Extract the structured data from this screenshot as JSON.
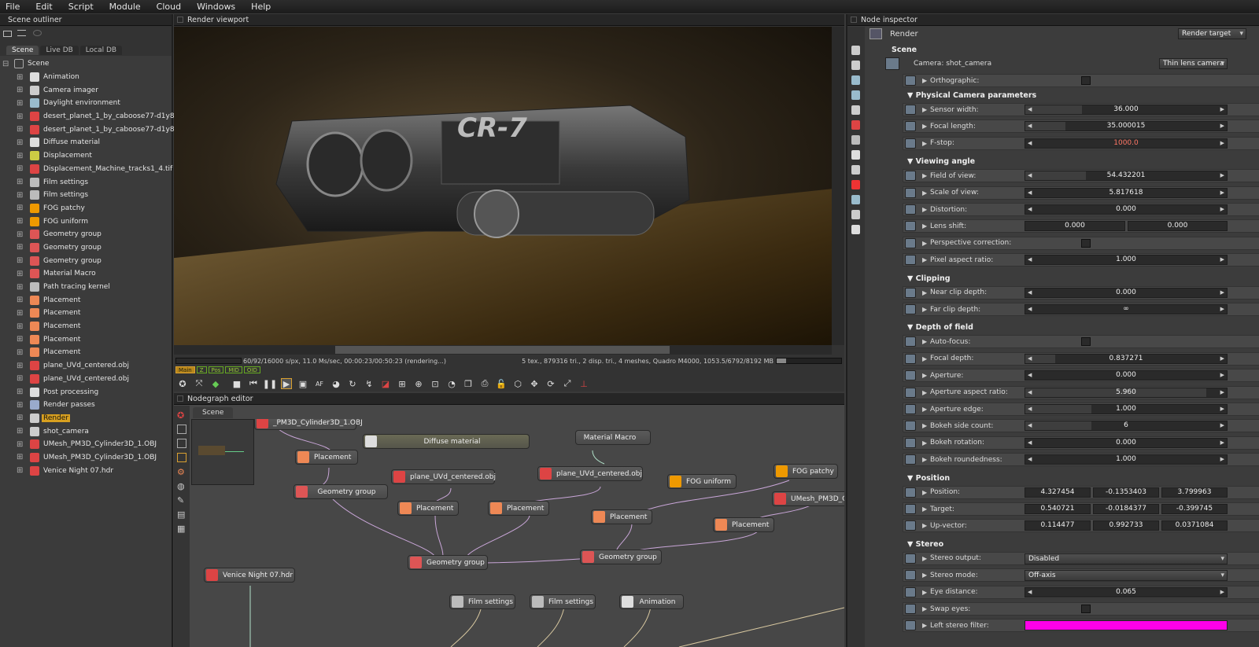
{
  "menu": [
    "File",
    "Edit",
    "Script",
    "Module",
    "Cloud",
    "Windows",
    "Help"
  ],
  "outliner": {
    "title": "Scene outliner",
    "tabs": [
      "Scene",
      "Live DB",
      "Local DB"
    ],
    "root": "Scene",
    "items": [
      {
        "label": "Animation",
        "icon": "clock-icon",
        "color": "#ddd"
      },
      {
        "label": "Camera imager",
        "icon": "image-icon",
        "color": "#ccc"
      },
      {
        "label": "Daylight environment",
        "icon": "sky-icon",
        "color": "#9bc"
      },
      {
        "label": "desert_planet_1_by_caboose77-d1y8xpn",
        "icon": "texture-icon",
        "color": "#d44"
      },
      {
        "label": "desert_planet_1_by_caboose77-d1y8xpn",
        "icon": "texture-icon",
        "color": "#d44"
      },
      {
        "label": "Diffuse material",
        "icon": "sphere-icon",
        "color": "#ddd"
      },
      {
        "label": "Displacement",
        "icon": "displacement-icon",
        "color": "#cc4"
      },
      {
        "label": "Displacement_Machine_tracks1_4.tif",
        "icon": "texture-icon",
        "color": "#d44"
      },
      {
        "label": "Film settings",
        "icon": "film-icon",
        "color": "#bbb"
      },
      {
        "label": "Film settings",
        "icon": "film-icon",
        "color": "#bbb"
      },
      {
        "label": "FOG patchy",
        "icon": "flame-icon",
        "color": "#e90"
      },
      {
        "label": "FOG uniform",
        "icon": "flame-icon",
        "color": "#e90"
      },
      {
        "label": "Geometry group",
        "icon": "geometry-icon",
        "color": "#d55"
      },
      {
        "label": "Geometry group",
        "icon": "geometry-icon",
        "color": "#d55"
      },
      {
        "label": "Geometry group",
        "icon": "geometry-icon",
        "color": "#d55"
      },
      {
        "label": "Material Macro",
        "icon": "macro-icon",
        "color": "#d55"
      },
      {
        "label": "Path tracing kernel",
        "icon": "kernel-icon",
        "color": "#bbb"
      },
      {
        "label": "Placement",
        "icon": "placement-icon",
        "color": "#e85"
      },
      {
        "label": "Placement",
        "icon": "placement-icon",
        "color": "#e85"
      },
      {
        "label": "Placement",
        "icon": "placement-icon",
        "color": "#e85"
      },
      {
        "label": "Placement",
        "icon": "placement-icon",
        "color": "#e85"
      },
      {
        "label": "Placement",
        "icon": "placement-icon",
        "color": "#e85"
      },
      {
        "label": "plane_UVd_centered.obj",
        "icon": "mesh-icon",
        "color": "#d44"
      },
      {
        "label": "plane_UVd_centered.obj",
        "icon": "mesh-icon",
        "color": "#d44"
      },
      {
        "label": "Post processing",
        "icon": "sun-icon",
        "color": "#ddd"
      },
      {
        "label": "Render passes",
        "icon": "passes-icon",
        "color": "#9ac"
      },
      {
        "label": "Render",
        "icon": "render-icon",
        "color": "#ccc",
        "selected": true
      },
      {
        "label": "shot_camera",
        "icon": "camera-icon",
        "color": "#ccc"
      },
      {
        "label": "UMesh_PM3D_Cylinder3D_1.OBJ",
        "icon": "mesh-icon",
        "color": "#d44"
      },
      {
        "label": "UMesh_PM3D_Cylinder3D_1.OBJ",
        "icon": "mesh-icon",
        "color": "#d44"
      },
      {
        "label": "Venice Night 07.hdr",
        "icon": "texture-icon",
        "color": "#d44"
      }
    ]
  },
  "viewport": {
    "title": "Render viewport",
    "status_left": "60/92/16000 s/px, 11.0 Ms/sec, 00:00:23/00:50:23 (rendering...)",
    "status_right": "5 tex., 879316 tri., 2 disp. tri., 4 meshes, Quadro M4000, 1053.5/6792/8192 MB",
    "tags": [
      "Main",
      "Z",
      "Pos",
      "MID",
      "OID"
    ],
    "gun_text": "CR-7"
  },
  "nodegraph": {
    "title": "Nodegraph editor",
    "tab": "Scene",
    "nodes": [
      {
        "id": "n1",
        "label": "_PM3D_Cylinder3D_1.OBJ"
      },
      {
        "id": "n2",
        "label": "Placement"
      },
      {
        "id": "n3",
        "label": "Geometry group"
      },
      {
        "id": "n4",
        "label": "Diffuse material"
      },
      {
        "id": "n5",
        "label": "plane_UVd_centered.obj"
      },
      {
        "id": "n6",
        "label": "Material Macro"
      },
      {
        "id": "n7",
        "label": "plane_UVd_centered.obj"
      },
      {
        "id": "n8",
        "label": "FOG uniform"
      },
      {
        "id": "n9",
        "label": "FOG patchy"
      },
      {
        "id": "n10",
        "label": "UMesh_PM3D_C"
      },
      {
        "id": "n11",
        "label": "Placement"
      },
      {
        "id": "n12",
        "label": "Placement"
      },
      {
        "id": "n13",
        "label": "Placement"
      },
      {
        "id": "n14",
        "label": "Placement"
      },
      {
        "id": "n15",
        "label": "Geometry group"
      },
      {
        "id": "n16",
        "label": "Geometry group"
      },
      {
        "id": "n17",
        "label": "Venice Night 07.hdr"
      },
      {
        "id": "n18",
        "label": "Film settings"
      },
      {
        "id": "n19",
        "label": "Film settings"
      },
      {
        "id": "n20",
        "label": "Animation"
      }
    ]
  },
  "inspector": {
    "title": "Node inspector",
    "node": "Render",
    "node_select": "Render target",
    "scene_label": "Scene",
    "camera_label": "Camera: shot_camera",
    "camera_type": "Thin lens camera",
    "orthographic": "Orthographic:",
    "physical": {
      "title": "Physical Camera parameters",
      "rows": [
        {
          "label": "Sensor width:",
          "value": "36.000",
          "fill": 0.28
        },
        {
          "label": "Focal length:",
          "value": "35.000015",
          "fill": 0.2
        },
        {
          "label": "F-stop:",
          "value": "1000.0",
          "fill": 0,
          "red": true
        }
      ]
    },
    "viewing": {
      "title": "Viewing angle",
      "rows": [
        {
          "label": "Field of view:",
          "value": "54.432201",
          "fill": 0.3
        },
        {
          "label": "Scale of view:",
          "value": "5.817618",
          "fill": 0
        },
        {
          "label": "Distortion:",
          "value": "0.000",
          "fill": 0
        },
        {
          "label": "Lens shift:",
          "value": "0.000",
          "value2": "0.000"
        },
        {
          "label": "Perspective correction:",
          "check": true
        },
        {
          "label": "Pixel aspect ratio:",
          "value": "1.000",
          "fill": 0
        }
      ]
    },
    "clipping": {
      "title": "Clipping",
      "rows": [
        {
          "label": "Near clip depth:",
          "value": "0.000",
          "fill": 0
        },
        {
          "label": "Far clip depth:",
          "value": "∞",
          "fill": 0
        }
      ]
    },
    "dof": {
      "title": "Depth of field",
      "rows": [
        {
          "label": "Auto-focus:",
          "check": true
        },
        {
          "label": "Focal depth:",
          "value": "0.837271",
          "fill": 0.15
        },
        {
          "label": "Aperture:",
          "value": "0.000",
          "fill": 0
        },
        {
          "label": "Aperture aspect ratio:",
          "value": "5.960",
          "fill": 0.9
        },
        {
          "label": "Aperture edge:",
          "value": "1.000",
          "fill": 0.33
        },
        {
          "label": "Bokeh side count:",
          "value": "6",
          "fill": 0.33
        },
        {
          "label": "Bokeh rotation:",
          "value": "0.000",
          "fill": 0
        },
        {
          "label": "Bokeh roundedness:",
          "value": "1.000",
          "fill": 0
        }
      ]
    },
    "position": {
      "title": "Position",
      "rows": [
        {
          "label": "Position:",
          "v": [
            "4.327454",
            "-0.1353403",
            "3.799963"
          ]
        },
        {
          "label": "Target:",
          "v": [
            "0.540721",
            "-0.0184377",
            "-0.399745"
          ]
        },
        {
          "label": "Up-vector:",
          "v": [
            "0.114477",
            "0.992733",
            "0.0371084"
          ]
        }
      ]
    },
    "stereo": {
      "title": "Stereo",
      "rows": [
        {
          "label": "Stereo output:",
          "select": "Disabled"
        },
        {
          "label": "Stereo mode:",
          "select": "Off-axis"
        },
        {
          "label": "Eye distance:",
          "value": "0.065",
          "fill": 0
        },
        {
          "label": "Swap eyes:",
          "check": true
        },
        {
          "label": "Left stereo filter:",
          "color": "#ff00e8"
        }
      ]
    }
  }
}
